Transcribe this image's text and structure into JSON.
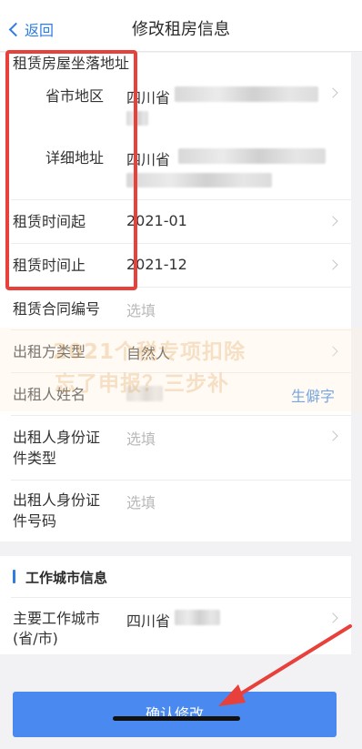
{
  "header": {
    "back_label": "返回",
    "title": "修改租房信息"
  },
  "rental_address": {
    "section_label": "租赁房屋坐落地址",
    "province_label": "省市地区",
    "province_value": "四川省",
    "detail_label": "详细地址",
    "detail_value": "四川省"
  },
  "lease_start": {
    "label": "租赁时间起",
    "value": "2021-01"
  },
  "lease_end": {
    "label": "租赁时间止",
    "value": "2021-12"
  },
  "contract_no": {
    "label": "租赁合同编号",
    "placeholder": "选填"
  },
  "lessor_type": {
    "label": "出租方类型",
    "value": "自然人"
  },
  "lessor_name": {
    "label": "出租人姓名",
    "hint": "生僻字"
  },
  "lessor_id_type": {
    "label_line1": "出租人身份证",
    "label_line2": "件类型",
    "placeholder": "选填"
  },
  "lessor_id_no": {
    "label_line1": "出租人身份证",
    "label_line2": "件号码",
    "placeholder": "选填"
  },
  "work_city": {
    "section_title": "工作城市信息",
    "label_line1": "主要工作城市",
    "label_line2": "(省/市)",
    "value": "四川省"
  },
  "watermark": {
    "line1": "2021个税专项扣除",
    "line2": "忘了申报？三步补"
  },
  "confirm_label": "确认修改",
  "colors": {
    "accent": "#2f7de1",
    "button": "#4a8af0",
    "annotation": "#e8403a"
  }
}
